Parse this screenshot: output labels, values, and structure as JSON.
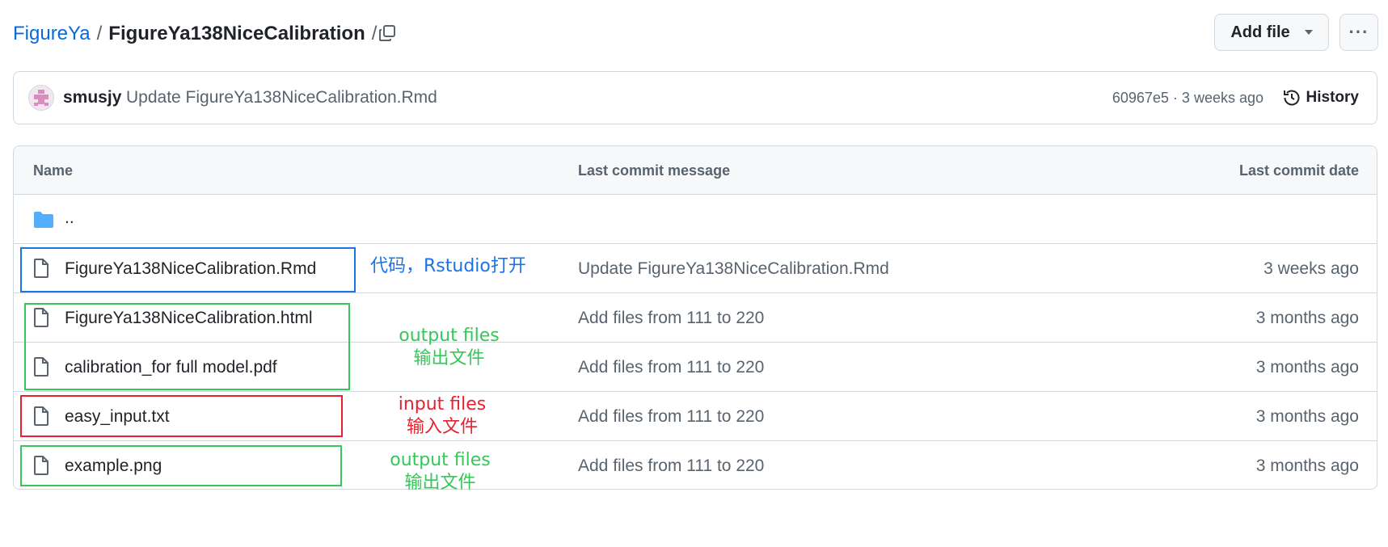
{
  "breadcrumb": {
    "owner": "FigureYa",
    "separator": "/",
    "repo": "FigureYa138NiceCalibration",
    "trailing": "/"
  },
  "actions": {
    "add_file_label": "Add file",
    "more_label": "···"
  },
  "commit": {
    "author": "smusjy",
    "message": "Update FigureYa138NiceCalibration.Rmd",
    "meta": "60967e5 · 3 weeks ago",
    "history_label": "History"
  },
  "table": {
    "headers": {
      "name": "Name",
      "message": "Last commit message",
      "date": "Last commit date"
    },
    "parent_label": "..",
    "rows": [
      {
        "name": "FigureYa138NiceCalibration.Rmd",
        "message": "Update FigureYa138NiceCalibration.Rmd",
        "date": "3 weeks ago"
      },
      {
        "name": "FigureYa138NiceCalibration.html",
        "message": "Add files from 111 to 220",
        "date": "3 months ago"
      },
      {
        "name": "calibration_for full model.pdf",
        "message": "Add files from 111 to 220",
        "date": "3 months ago"
      },
      {
        "name": "easy_input.txt",
        "message": "Add files from 111 to 220",
        "date": "3 months ago"
      },
      {
        "name": "example.png",
        "message": "Add files from 111 to 220",
        "date": "3 months ago"
      }
    ]
  },
  "annotations": {
    "code": {
      "text": "代码，Rstudio打开",
      "color": "#1a73e8"
    },
    "output1": {
      "line1": "output files",
      "line2": "输出文件",
      "color": "#34c759"
    },
    "input": {
      "line1": "input files",
      "line2": "输入文件",
      "color": "#e8212f"
    },
    "output2": {
      "line1": "output files",
      "line2": "输出文件",
      "color": "#34c759"
    }
  },
  "colors": {
    "link": "#0969da",
    "muted": "#59636e",
    "border": "#d1d9e0",
    "folder": "#54aeff"
  },
  "icons": [
    "copy-icon",
    "history-icon",
    "folder-icon",
    "file-icon",
    "avatar-icon",
    "caret-down-icon",
    "kebab-icon"
  ]
}
